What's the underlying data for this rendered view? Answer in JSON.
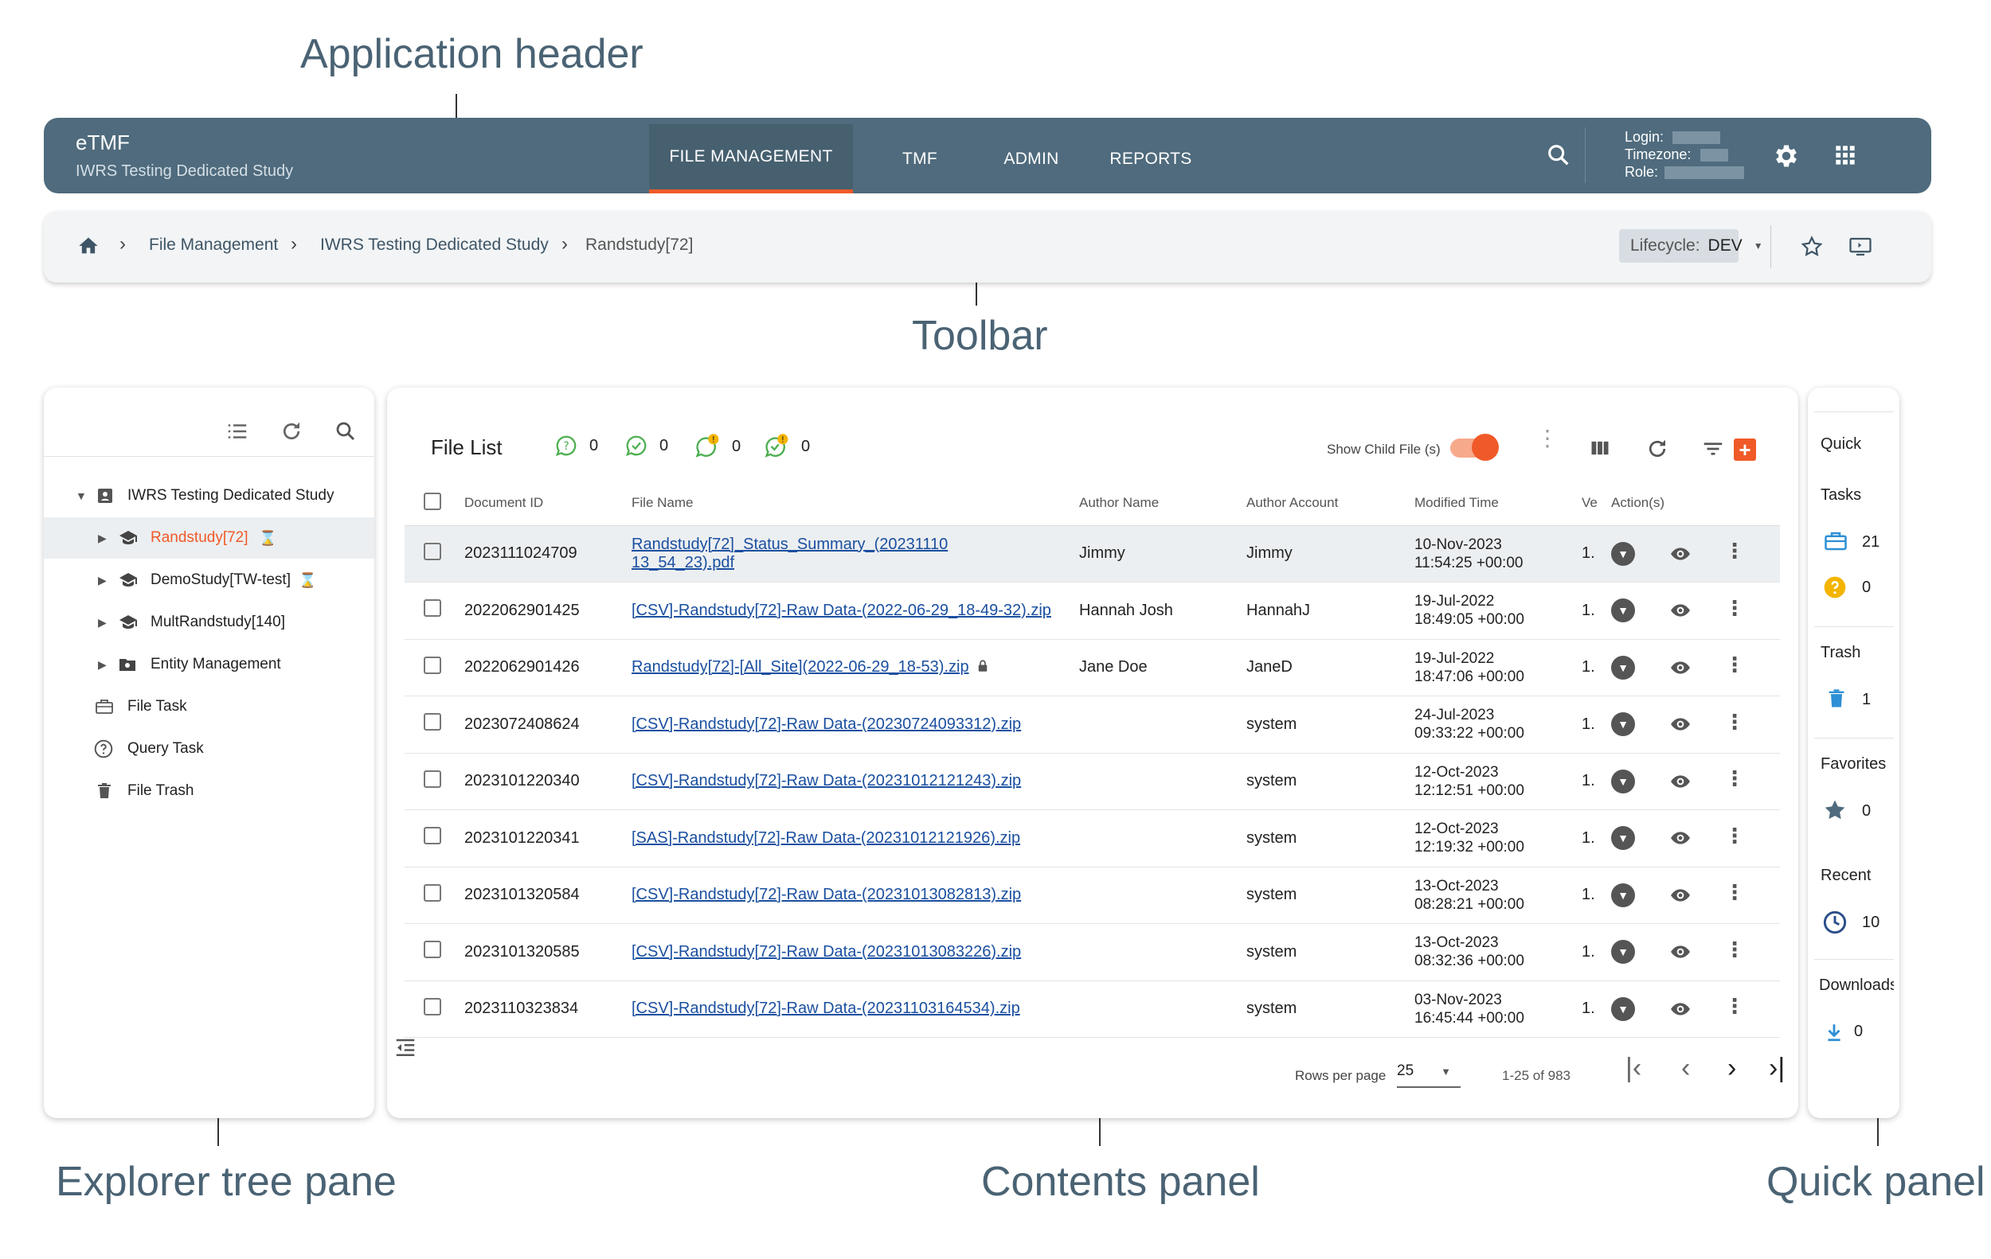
{
  "annotations": {
    "header": "Application header",
    "toolbar": "Toolbar",
    "explorer": "Explorer tree pane",
    "contents": "Contents panel",
    "quick": "Quick panel"
  },
  "header": {
    "app_name": "eTMF",
    "study": "IWRS Testing Dedicated Study",
    "tabs": [
      "FILE MANAGEMENT",
      "TMF",
      "ADMIN",
      "REPORTS"
    ],
    "active_tab": "FILE MANAGEMENT",
    "login_label": "Login:",
    "timezone_label": "Timezone:",
    "role_label": "Role:",
    "colors": {
      "bar": "#4f6b7d",
      "accent": "#f05a28"
    }
  },
  "toolbar": {
    "breadcrumb": [
      "File Management",
      "IWRS Testing Dedicated Study",
      "Randstudy[72]"
    ],
    "lifecycle_label": "Lifecycle:",
    "lifecycle_value": "DEV"
  },
  "explorer": {
    "root": "IWRS Testing Dedicated Study",
    "items": [
      "Randstudy[72]",
      "DemoStudy[TW-test]",
      "MultRandstudy[140]",
      "Entity Management"
    ],
    "tasks": [
      "File Task",
      "Query Task",
      "File Trash"
    ]
  },
  "contents": {
    "title": "File List",
    "counters": [
      "0",
      "0",
      "0",
      "0"
    ],
    "show_child_label": "Show Child File (s)",
    "columns": [
      "Document ID",
      "File Name",
      "Author Name",
      "Author Account",
      "Modified Time",
      "Ve",
      "Action(s)"
    ],
    "rows": [
      {
        "id": "2023111024709",
        "name": "Randstudy[72]_Status_Summary_(20231110",
        "name2": "13_54_23).pdf",
        "author": "Jimmy",
        "account": "Jimmy",
        "date": "10-Nov-2023",
        "time": "11:54:25 +00:00",
        "ver": "1."
      },
      {
        "id": "2022062901425",
        "name": "[CSV]-Randstudy[72]-Raw Data-(2022-06-29_18-49-32).zip",
        "name2": "",
        "author": "Hannah Josh",
        "account": "HannahJ",
        "date": "19-Jul-2022",
        "time": "18:49:05 +00:00",
        "ver": "1."
      },
      {
        "id": "2022062901426",
        "name": "Randstudy[72]-[All_Site](2022-06-29_18-53).zip",
        "name2": "",
        "author": "Jane Doe",
        "account": "JaneD",
        "date": "19-Jul-2022",
        "time": "18:47:06 +00:00",
        "ver": "1."
      },
      {
        "id": "2023072408624",
        "name": "[CSV]-Randstudy[72]-Raw Data-(20230724093312).zip",
        "name2": "",
        "author": "",
        "account": "system",
        "date": "24-Jul-2023",
        "time": "09:33:22 +00:00",
        "ver": "1."
      },
      {
        "id": "2023101220340",
        "name": "[CSV]-Randstudy[72]-Raw Data-(20231012121243).zip",
        "name2": "",
        "author": "",
        "account": "system",
        "date": "12-Oct-2023",
        "time": "12:12:51 +00:00",
        "ver": "1."
      },
      {
        "id": "2023101220341",
        "name": "[SAS]-Randstudy[72]-Raw Data-(20231012121926).zip",
        "name2": "",
        "author": "",
        "account": "system",
        "date": "12-Oct-2023",
        "time": "12:19:32 +00:00",
        "ver": "1."
      },
      {
        "id": "2023101320584",
        "name": "[CSV]-Randstudy[72]-Raw Data-(20231013082813).zip",
        "name2": "",
        "author": "",
        "account": "system",
        "date": "13-Oct-2023",
        "time": "08:28:21 +00:00",
        "ver": "1."
      },
      {
        "id": "2023101320585",
        "name": "[CSV]-Randstudy[72]-Raw Data-(20231013083226).zip",
        "name2": "",
        "author": "",
        "account": "system",
        "date": "13-Oct-2023",
        "time": "08:32:36 +00:00",
        "ver": "1."
      },
      {
        "id": "2023110323834",
        "name": "[CSV]-Randstudy[72]-Raw Data-(20231103164534).zip",
        "name2": "",
        "author": "",
        "account": "system",
        "date": "03-Nov-2023",
        "time": "16:45:44 +00:00",
        "ver": "1."
      }
    ],
    "rows_per_page_label": "Rows per page",
    "rows_per_page": "25",
    "page_range": "1-25 of 983"
  },
  "quick": {
    "title": "Quick",
    "tasks_label": "Tasks",
    "tasks_count_1": "21",
    "tasks_count_2": "0",
    "trash_label": "Trash",
    "trash_count": "1",
    "favorites_label": "Favorites",
    "favorites_count": "0",
    "recent_label": "Recent",
    "recent_count": "10",
    "downloads_label": "Downloads",
    "downloads_count": "0"
  }
}
